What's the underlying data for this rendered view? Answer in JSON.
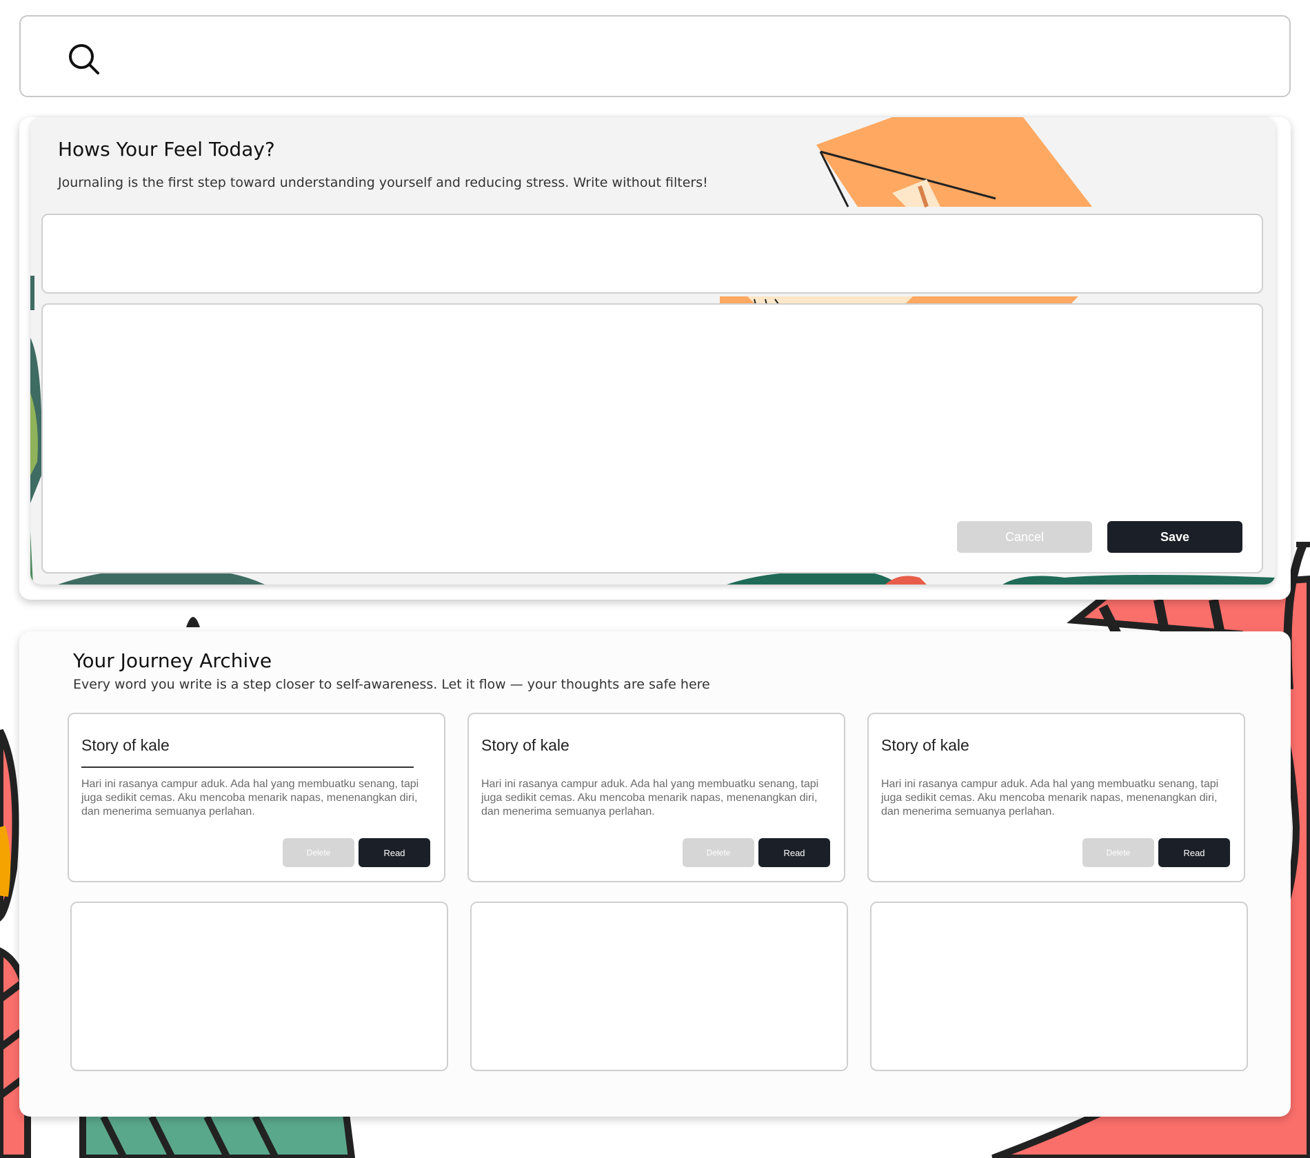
{
  "search": {
    "icon": "search-icon",
    "placeholder": ""
  },
  "journal": {
    "title": "Hows Your Feel Today?",
    "subtitle": "Journaling is the first step toward understanding yourself and reducing stress. Write without filters!",
    "title_field": {
      "value": "",
      "placeholder": ""
    },
    "body_field": {
      "value": "",
      "placeholder": ""
    },
    "cancel_label": "Cancel",
    "save_label": "Save"
  },
  "archive": {
    "title": "Your Journey Archive",
    "subtitle": "Every word you write is a step closer to self-awareness. Let it flow — your thoughts are safe here",
    "stories": [
      {
        "title": "Story of kale",
        "excerpt": "Hari ini rasanya campur aduk. Ada hal yang membuatku senang, tapi juga sedikit cemas. Aku mencoba menarik napas, menenangkan diri, dan menerima semuanya perlahan.",
        "delete_label": "Delete",
        "read_label": "Read"
      },
      {
        "title": "Story of kale",
        "excerpt": "Hari ini rasanya campur aduk. Ada hal yang membuatku senang, tapi juga sedikit cemas. Aku mencoba menarik napas, menenangkan diri, dan menerima semuanya perlahan.",
        "delete_label": "Delete",
        "read_label": "Read"
      },
      {
        "title": "Story of kale",
        "excerpt": "Hari ini rasanya campur aduk. Ada hal yang membuatku senang, tapi juga sedikit cemas. Aku mencoba menarik napas, menenangkan diri, dan menerima semuanya perlahan.",
        "delete_label": "Delete",
        "read_label": "Read"
      }
    ],
    "empty_cards": 3
  },
  "colors": {
    "primary_button": "#1b1f27",
    "disabled_button": "#d6d6d6",
    "card_border": "#cfcfcf",
    "illustration_orange": "#fea862",
    "illustration_coral": "#fb6f6b",
    "illustration_green": "#5aa88c"
  }
}
